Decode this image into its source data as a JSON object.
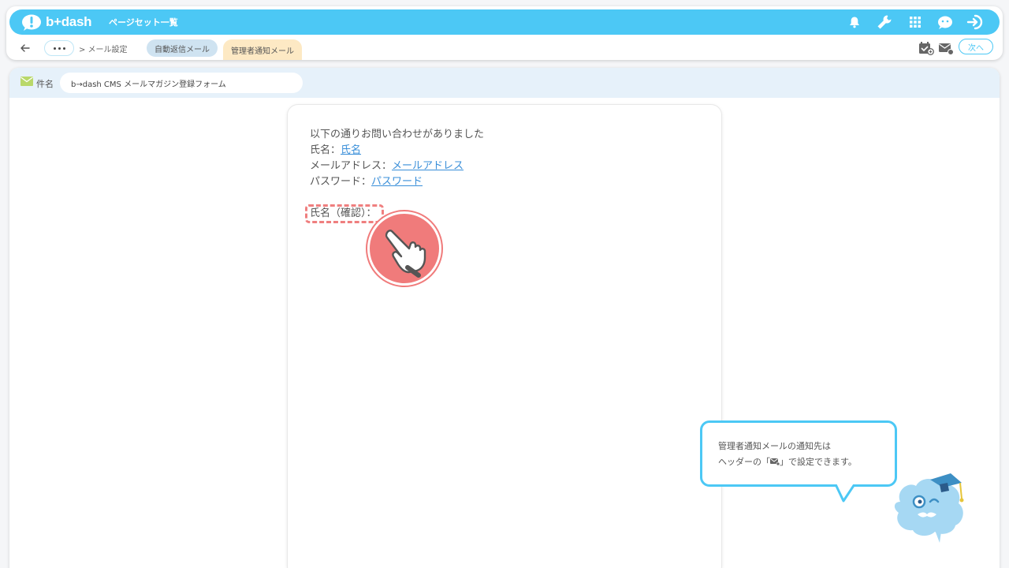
{
  "header": {
    "logo_text": "b+dash",
    "title": "ページセット一覧",
    "icons": [
      "bell-icon",
      "wrench-icon",
      "grid-icon",
      "support-icon",
      "logout-icon"
    ]
  },
  "nav": {
    "breadcrumb": "> メール設定",
    "tabs": [
      {
        "label": "自動返信メール",
        "active": false
      },
      {
        "label": "管理者通知メール",
        "active": true
      }
    ],
    "next_label": "次へ"
  },
  "subject": {
    "label": "件名",
    "value": "b→dash CMS メールマガジン登録フォーム"
  },
  "mail_body": {
    "intro": "以下の通りお問い合わせがありました",
    "fields": [
      {
        "label": "氏名：",
        "link": "氏名"
      },
      {
        "label": "メールアドレス：",
        "link": "メールアドレス"
      },
      {
        "label": "パスワード：",
        "link": "パスワード"
      }
    ],
    "confirm_label": "氏名（確認）："
  },
  "tooltip": {
    "line1": "管理者通知メールの通知先は",
    "line2_prefix": "ヘッダーの「",
    "line2_suffix": "」で設定できます。"
  },
  "colors": {
    "accent": "#4cc8f5",
    "highlight": "#ef7f7f",
    "active_tab": "#fde9c4",
    "inactive_tab": "#cfe3f1"
  }
}
